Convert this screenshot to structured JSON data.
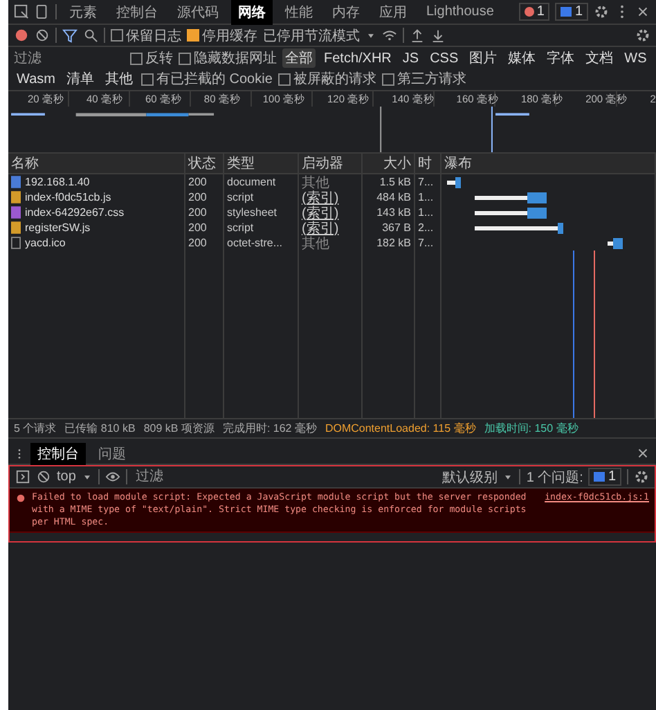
{
  "main_tabs": [
    {
      "label": "元素",
      "selected": false
    },
    {
      "label": "控制台",
      "selected": false
    },
    {
      "label": "源代码",
      "selected": false
    },
    {
      "label": "网络",
      "selected": true
    },
    {
      "label": "性能",
      "selected": false
    },
    {
      "label": "内存",
      "selected": false
    },
    {
      "label": "应用",
      "selected": false
    },
    {
      "label": "Lighthouse",
      "selected": false
    }
  ],
  "badges": {
    "errors": "1",
    "messages": "1"
  },
  "toolbar": {
    "recording": true,
    "preserve_log": {
      "label": "保留日志",
      "checked": false
    },
    "disable_cache": {
      "label": "停用缓存",
      "checked": true
    },
    "throttle": "已停用节流模式"
  },
  "filter": {
    "placeholder": "过滤",
    "options": [
      {
        "label": "反转",
        "checked": false
      },
      {
        "label": "隐藏数据网址",
        "checked": false
      }
    ],
    "types": [
      {
        "label": "全部",
        "selected": true
      },
      {
        "label": "Fetch/XHR",
        "selected": false
      },
      {
        "label": "JS",
        "selected": false
      },
      {
        "label": "CSS",
        "selected": false
      },
      {
        "label": "图片",
        "selected": false
      },
      {
        "label": "媒体",
        "selected": false
      },
      {
        "label": "字体",
        "selected": false
      },
      {
        "label": "文档",
        "selected": false
      },
      {
        "label": "WS",
        "selected": false
      },
      {
        "label": "Wasm",
        "selected": false
      },
      {
        "label": "清单",
        "selected": false
      },
      {
        "label": "其他",
        "selected": false
      }
    ],
    "more_options": [
      {
        "label": "有已拦截的 Cookie",
        "checked": false
      },
      {
        "label": "被屏蔽的请求",
        "checked": false
      },
      {
        "label": "第三方请求",
        "checked": false
      }
    ]
  },
  "overview": {
    "ticks": [
      "20 毫秒",
      "40 毫秒",
      "60 毫秒",
      "80 毫秒",
      "100 毫秒",
      "120 毫秒",
      "140 毫秒",
      "160 毫秒",
      "180 毫秒",
      "200 毫秒",
      "2"
    ]
  },
  "table": {
    "columns": [
      "名称",
      "状态",
      "类型",
      "启动器",
      "大小",
      "时",
      "瀑布"
    ],
    "rows": [
      {
        "kind": "document",
        "name": "192.168.1.40",
        "status": "200",
        "type": "document",
        "initiator": "其他",
        "initiator_link": false,
        "size": "1.5 kB",
        "time": "7..."
      },
      {
        "kind": "script",
        "name": "index-f0dc51cb.js",
        "status": "200",
        "type": "script",
        "initiator": "(索引)",
        "initiator_link": true,
        "size": "484 kB",
        "time": "1..."
      },
      {
        "kind": "stylesheet",
        "name": "index-64292e67.css",
        "status": "200",
        "type": "stylesheet",
        "initiator": "(索引)",
        "initiator_link": true,
        "size": "143 kB",
        "time": "1..."
      },
      {
        "kind": "script",
        "name": "registerSW.js",
        "status": "200",
        "type": "script",
        "initiator": "(索引)",
        "initiator_link": true,
        "size": "367 B",
        "time": "2..."
      },
      {
        "kind": "other",
        "name": "yacd.ico",
        "status": "200",
        "type": "octet-stre...",
        "initiator": "其他",
        "initiator_link": false,
        "size": "182 kB",
        "time": "7..."
      }
    ]
  },
  "status_bar": [
    {
      "kind": "plain",
      "text": "5 个请求"
    },
    {
      "kind": "plain",
      "text": "已传输 810 kB"
    },
    {
      "kind": "plain",
      "text": "809 kB 项资源"
    },
    {
      "kind": "plain",
      "text": "完成用时: 162 毫秒"
    },
    {
      "kind": "dom",
      "text": "DOMContentLoaded: 115 毫秒"
    },
    {
      "kind": "load",
      "text": "加载时间: 150 毫秒"
    }
  ],
  "drawer_tabs": [
    {
      "label": "控制台",
      "selected": true
    },
    {
      "label": "问题",
      "selected": false
    }
  ],
  "console": {
    "context": "top",
    "filter_placeholder": "过滤",
    "level": "默认级别",
    "issues": "1 个问题:",
    "issue_count": "1",
    "messages": [
      {
        "kind": "error",
        "text": "Failed to load module script: Expected a JavaScript module script but the server responded with a MIME type of \"text/plain\". Strict MIME type checking is enforced for module scripts per HTML spec.",
        "source": "index-f0dc51cb.js:1"
      }
    ]
  }
}
